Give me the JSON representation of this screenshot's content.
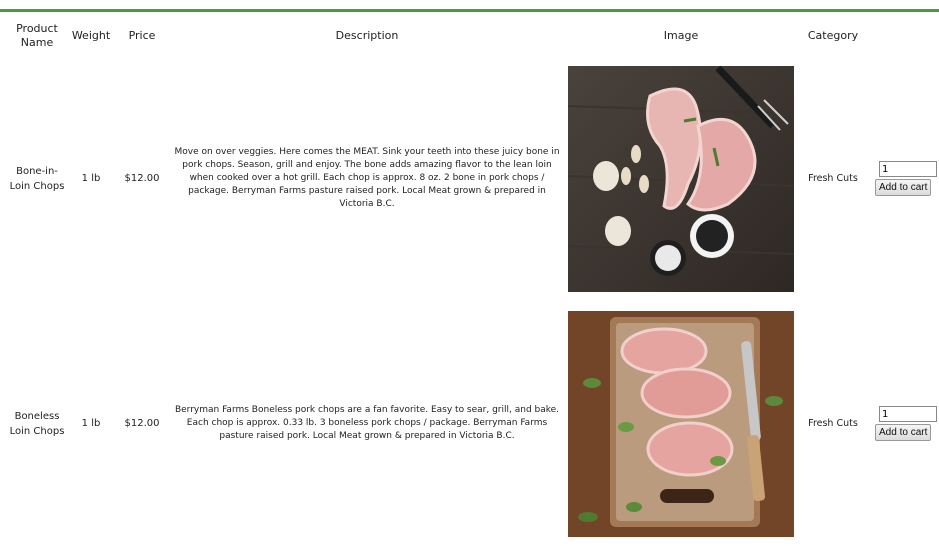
{
  "columns": {
    "product_name": "Product Name",
    "weight": "Weight",
    "price": "Price",
    "description": "Description",
    "image": "Image",
    "category": "Category"
  },
  "products": [
    {
      "name": "Bone-in-Loin Chops",
      "weight": "1 lb",
      "price": "$12.00",
      "description": "Move on over veggies. Here comes the MEAT. Sink your teeth into these juicy bone in pork chops. Season, grill and enjoy. The bone adds amazing flavor to the lean loin when cooked over a hot grill. Each chop is approx. 8 oz. 2 bone in pork chops / package. Berryman Farms pasture raised pork. Local Meat grown & prepared in Victoria B.C.",
      "category": "Fresh Cuts",
      "quantity": "1",
      "add_to_cart": "Add to cart"
    },
    {
      "name": "Boneless Loin Chops",
      "weight": "1 lb",
      "price": "$12.00",
      "description": "Berryman Farms Boneless pork chops are a fan favorite. Easy to sear, grill, and bake. Each chop is approx. 0.33 lb. 3 boneless pork chops / package. Berryman Farms pasture raised pork. Local Meat grown & prepared in Victoria B.C.",
      "category": "Fresh Cuts",
      "quantity": "1",
      "add_to_cart": "Add to cart"
    }
  ]
}
